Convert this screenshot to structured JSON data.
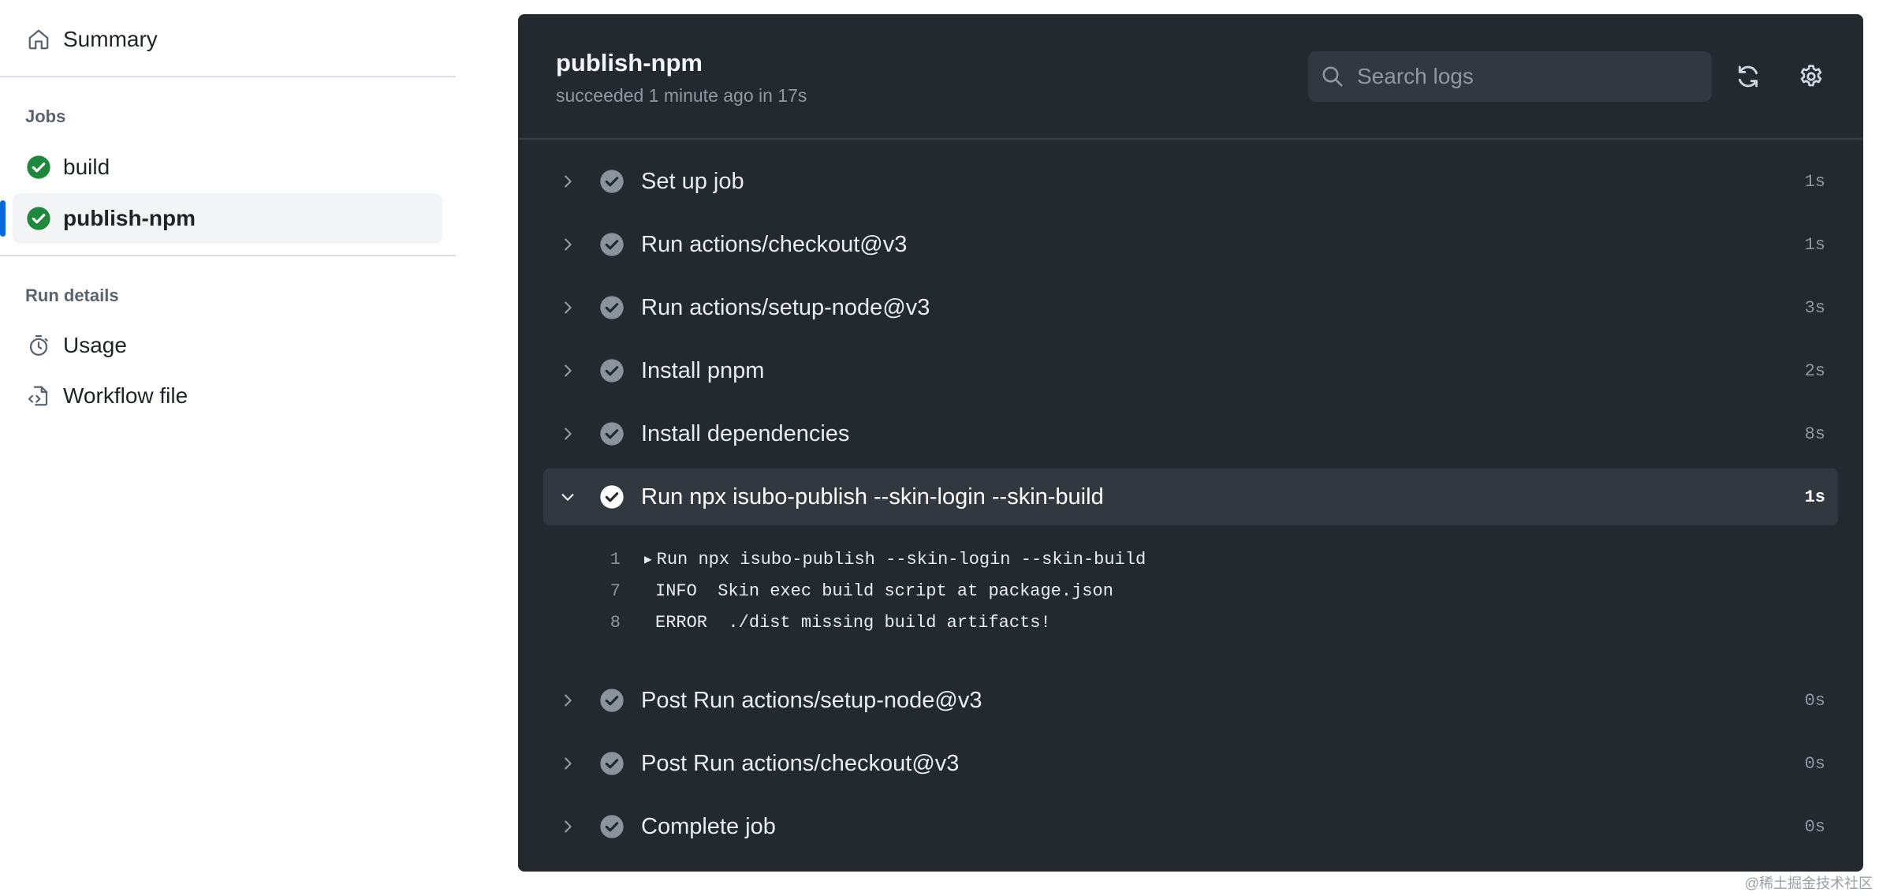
{
  "sidebar": {
    "summary_label": "Summary",
    "jobs_heading": "Jobs",
    "jobs": [
      {
        "label": "build",
        "status": "success"
      },
      {
        "label": "publish-npm",
        "status": "success",
        "active": true
      }
    ],
    "run_details_heading": "Run details",
    "details": [
      {
        "label": "Usage",
        "icon": "stopwatch-icon"
      },
      {
        "label": "Workflow file",
        "icon": "file-code-icon"
      }
    ]
  },
  "job": {
    "title": "publish-npm",
    "status": "succeeded 1 minute ago in 17s"
  },
  "search": {
    "placeholder": "Search logs"
  },
  "header_actions": {
    "refresh_icon": "sync-icon",
    "settings_icon": "gear-icon"
  },
  "steps": [
    {
      "name": "Set up job",
      "duration": "1s"
    },
    {
      "name": "Run actions/checkout@v3",
      "duration": "1s"
    },
    {
      "name": "Run actions/setup-node@v3",
      "duration": "3s"
    },
    {
      "name": "Install pnpm",
      "duration": "2s"
    },
    {
      "name": "Install dependencies",
      "duration": "8s"
    },
    {
      "name": "Run npx isubo-publish --skin-login --skin-build",
      "duration": "1s",
      "expanded": true
    },
    {
      "name": "Post Run actions/setup-node@v3",
      "duration": "0s"
    },
    {
      "name": "Post Run actions/checkout@v3",
      "duration": "0s"
    },
    {
      "name": "Complete job",
      "duration": "0s"
    }
  ],
  "log_lines": [
    {
      "num": "1",
      "text": "Run npx isubo-publish --skin-login --skin-build",
      "collapsible": true
    },
    {
      "num": "7",
      "text": "INFO  Skin exec build script at package.json"
    },
    {
      "num": "8",
      "text": "ERROR  ./dist missing build artifacts!"
    }
  ],
  "watermark": "@稀土掘金技术社区",
  "colors": {
    "success_green": "#1f883d",
    "active_indicator": "#0969da",
    "panel_bg": "#24292f"
  }
}
